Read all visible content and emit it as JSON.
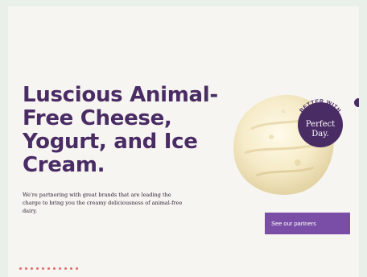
{
  "hero": {
    "headline": "Luscious Animal-Free Cheese, Yogurt, and Ice Cream.",
    "body": "We're partnering with great brands that are leading the charge to bring you the creamy deliciousness of animal-free dairy.",
    "cta_label": "See our partners"
  },
  "badge": {
    "arc_text": "BETTER WITH",
    "logo_line1": "Perfect",
    "logo_line2": "Day."
  },
  "colors": {
    "brand_purple": "#4a2c64",
    "cta_purple": "#7a4ea6",
    "accent_dot": "#e06a6a"
  },
  "decor": {
    "image": "ice-cream-scoop-image"
  }
}
